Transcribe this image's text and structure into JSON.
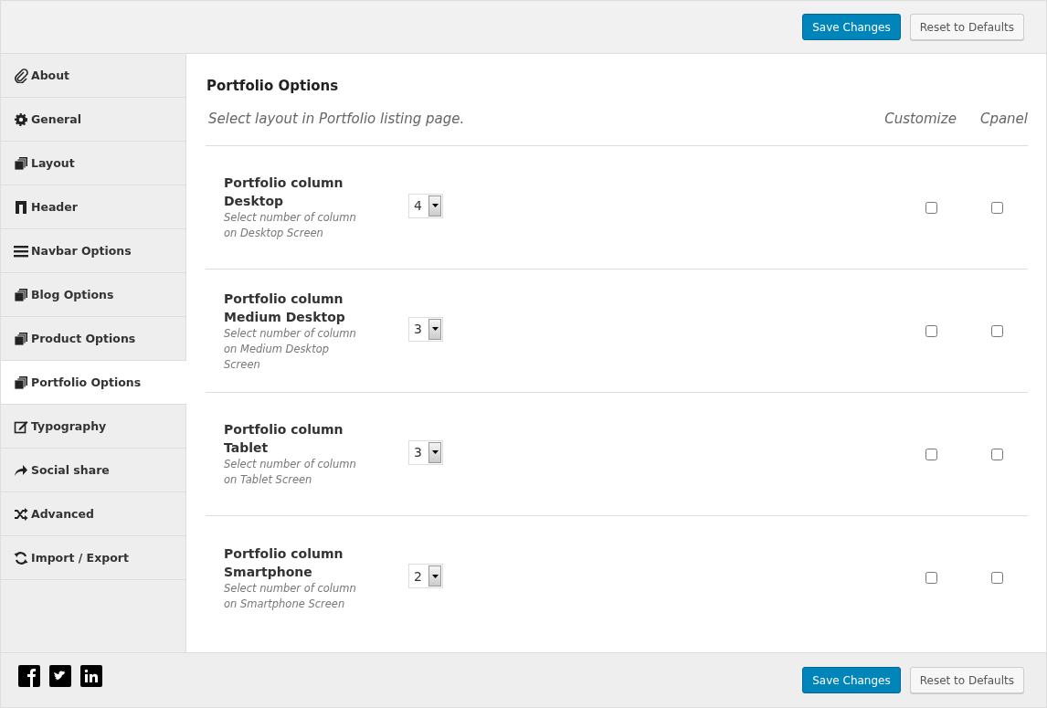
{
  "toolbar": {
    "save": "Save Changes",
    "reset": "Reset to Defaults"
  },
  "sidebar": {
    "items": [
      {
        "label": "About",
        "selected": false
      },
      {
        "label": "General",
        "selected": false
      },
      {
        "label": "Layout",
        "selected": false
      },
      {
        "label": "Header",
        "selected": false
      },
      {
        "label": "Navbar Options",
        "selected": false
      },
      {
        "label": "Blog Options",
        "selected": false
      },
      {
        "label": "Product Options",
        "selected": false
      },
      {
        "label": "Portfolio Options",
        "selected": true
      },
      {
        "label": "Typography",
        "selected": false
      },
      {
        "label": "Social share",
        "selected": false
      },
      {
        "label": "Advanced",
        "selected": false
      },
      {
        "label": "Import / Export",
        "selected": false
      }
    ]
  },
  "section": {
    "title": "Portfolio Options",
    "subtitle": "Select layout in Portfolio listing page.",
    "column_headers": [
      "Customize",
      "Cpanel"
    ],
    "options": [
      {
        "title": "Portfolio column Desktop",
        "description": "Select number of column on Desktop Screen",
        "value": "4",
        "customize": false,
        "cpanel": false
      },
      {
        "title": "Portfolio column Medium Desktop",
        "description": "Select number of column on Medium Desktop Screen",
        "value": "3",
        "customize": false,
        "cpanel": false
      },
      {
        "title": "Portfolio column Tablet",
        "description": "Select number of column on Tablet Screen",
        "value": "3",
        "customize": false,
        "cpanel": false
      },
      {
        "title": "Portfolio column Smartphone",
        "description": "Select number of column on Smartphone Screen",
        "value": "2",
        "customize": false,
        "cpanel": false
      }
    ]
  },
  "footer": {
    "save": "Save Changes",
    "reset": "Reset to Defaults"
  }
}
